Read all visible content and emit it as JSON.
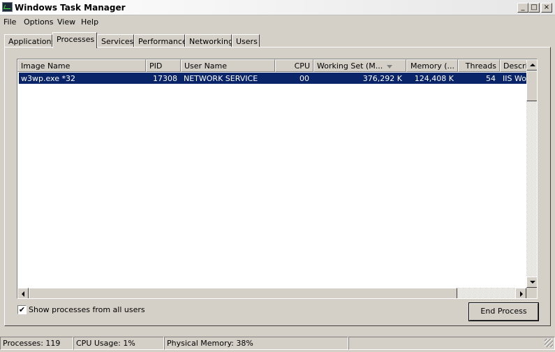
{
  "window": {
    "title": "Windows Task Manager"
  },
  "title_buttons": {
    "minimize": "_",
    "maximize": "□",
    "close": "×"
  },
  "menu": {
    "items": [
      "File",
      "Options",
      "View",
      "Help"
    ]
  },
  "tabs": [
    "Applications",
    "Processes",
    "Services",
    "Performance",
    "Networking",
    "Users"
  ],
  "active_tab": "Processes",
  "table": {
    "columns": [
      "Image Name",
      "PID",
      "User Name",
      "CPU",
      "Working Set (M...",
      "Memory (...",
      "Threads",
      "Descripti"
    ],
    "rows": [
      [
        "w3wp.exe *32",
        "17308",
        "NETWORK SERVICE",
        "00",
        "376,292 K",
        "124,408 K",
        "54",
        "IIS Wo"
      ]
    ],
    "sorted_column": "Working Set (M..."
  },
  "controls": {
    "show_all_label": "Show processes from all users",
    "show_all_checked": true,
    "end_process_label": "End Process",
    "checkmark": "✔"
  },
  "status": {
    "processes": "Processes: 119",
    "cpu": "CPU Usage: 1%",
    "memory": "Physical Memory: 38%"
  },
  "colors": {
    "selection": "#0a246a",
    "face": "#d4d0c8"
  }
}
